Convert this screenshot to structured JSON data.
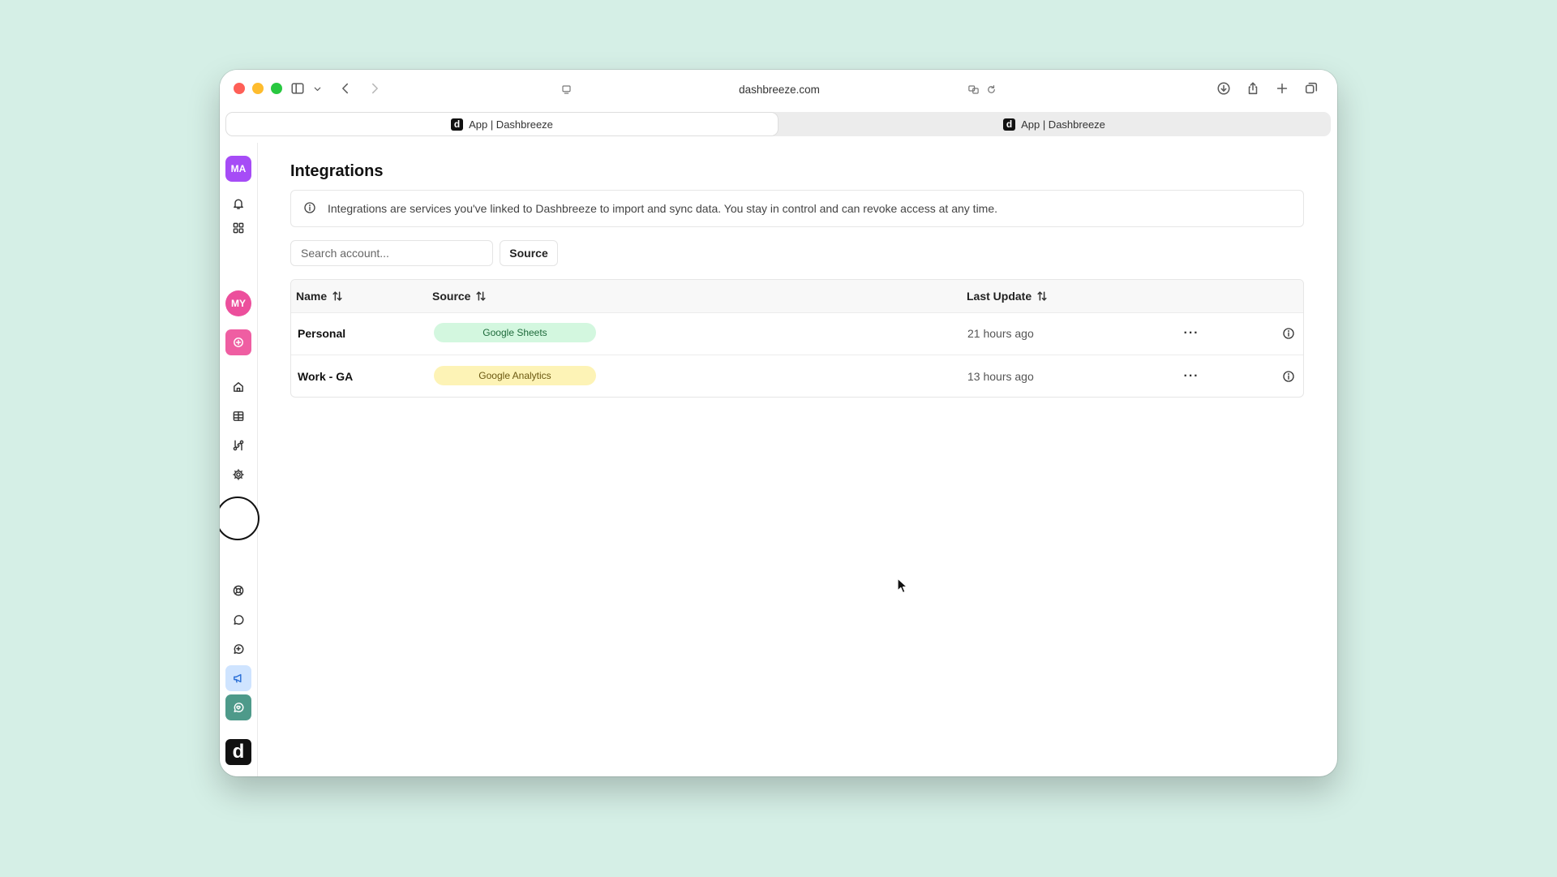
{
  "browser": {
    "url": "dashbreeze.com",
    "tabs": [
      {
        "title": "App | Dashbreeze",
        "favicon": "d",
        "active": true
      },
      {
        "title": "App | Dashbreeze",
        "favicon": "d",
        "active": false
      }
    ]
  },
  "sidebar": {
    "workspace_initials": "MA",
    "user_initials": "MY",
    "logo_letter": "d",
    "icons": [
      "bell-icon",
      "dashboard-grid-icon",
      "add-circle-icon",
      "home-icon",
      "table-icon",
      "integrations-icon",
      "settings-gear-icon",
      "help-lifebuoy-icon",
      "chat-icon",
      "feedback-plus-icon",
      "megaphone-icon",
      "heart-chat-icon"
    ],
    "active_item": "integrations"
  },
  "page": {
    "title": "Integrations",
    "info_text": "Integrations are services you've linked to Dashbreeze to import and sync data. You stay in control and can revoke access at any time.",
    "search_placeholder": "Search account...",
    "source_filter_label": "Source"
  },
  "table": {
    "columns": {
      "name": "Name",
      "source": "Source",
      "last_update": "Last Update"
    },
    "rows": [
      {
        "name": "Personal",
        "source": "Google Sheets",
        "source_color": "#d3f7df",
        "last_update": "21 hours ago"
      },
      {
        "name": "Work - GA",
        "source": "Google Analytics",
        "source_color": "#fdf3b6",
        "last_update": "13 hours ago"
      }
    ],
    "row_menu_label": "···"
  },
  "colors": {
    "background": "#d5efe6",
    "avatar_ma": "#a64cf6",
    "avatar_my": "#ec4f9c"
  }
}
